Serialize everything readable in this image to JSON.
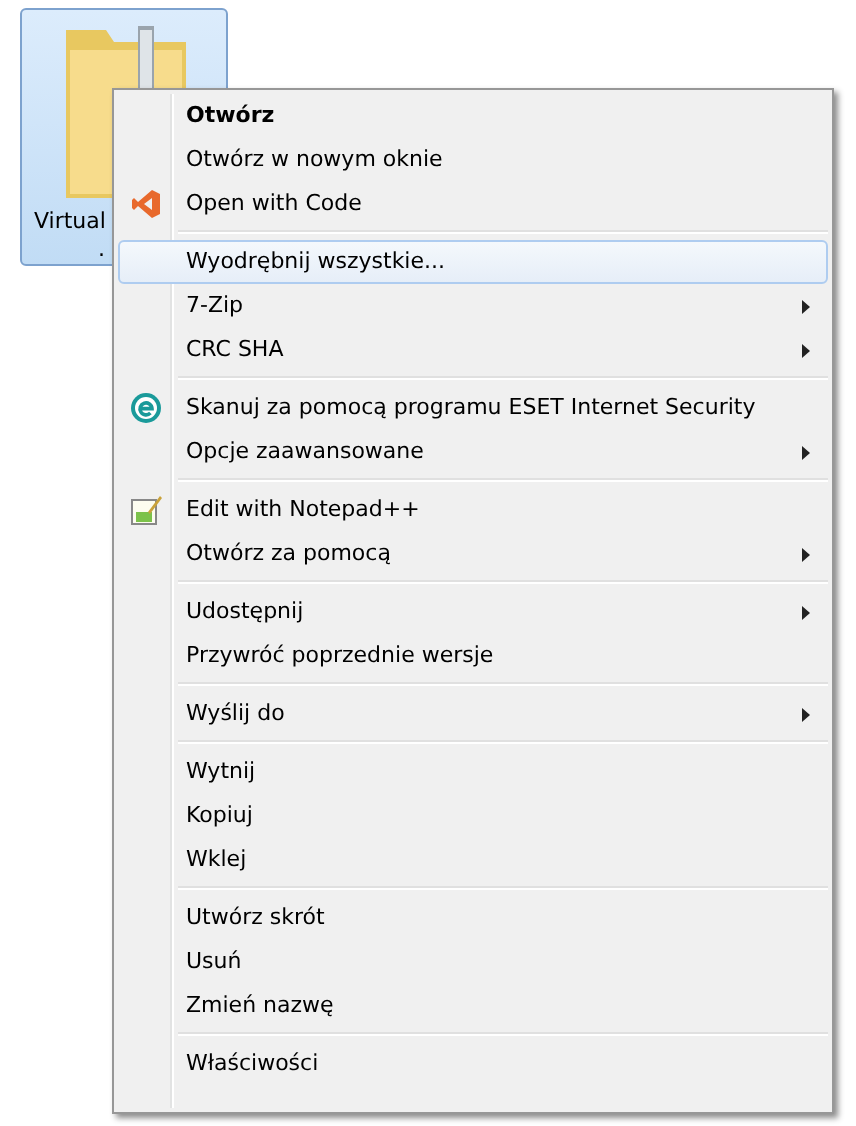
{
  "desktop_item": {
    "name_lines": [
      "Virtual",
      "."
    ],
    "selected": true
  },
  "context_menu": {
    "groups": [
      {
        "items": [
          {
            "label": "Otwórz",
            "default": true,
            "submenu": false,
            "selected": false
          },
          {
            "label": "Otwórz w nowym oknie",
            "default": false,
            "submenu": false,
            "selected": false
          },
          {
            "label": "Open with Code",
            "default": false,
            "submenu": false,
            "selected": false
          }
        ]
      },
      {
        "items": [
          {
            "label": "Wyodrębnij wszystkie...",
            "default": false,
            "submenu": false,
            "selected": true
          },
          {
            "label": "7-Zip",
            "default": false,
            "submenu": true,
            "selected": false
          },
          {
            "label": "CRC SHA",
            "default": false,
            "submenu": true,
            "selected": false
          }
        ]
      },
      {
        "items": [
          {
            "label": "Skanuj za pomocą programu ESET Internet Security",
            "default": false,
            "submenu": false,
            "selected": false
          },
          {
            "label": "Opcje zaawansowane",
            "default": false,
            "submenu": true,
            "selected": false
          }
        ]
      },
      {
        "items": [
          {
            "label": "Edit with Notepad++",
            "default": false,
            "submenu": false,
            "selected": false
          },
          {
            "label": "Otwórz za pomocą",
            "default": false,
            "submenu": true,
            "selected": false
          }
        ]
      },
      {
        "items": [
          {
            "label": "Udostępnij",
            "default": false,
            "submenu": true,
            "selected": false
          },
          {
            "label": "Przywróć poprzednie wersje",
            "default": false,
            "submenu": false,
            "selected": false
          }
        ]
      },
      {
        "items": [
          {
            "label": "Wyślij do",
            "default": false,
            "submenu": true,
            "selected": false
          }
        ]
      },
      {
        "items": [
          {
            "label": "Wytnij",
            "default": false,
            "submenu": false,
            "selected": false
          },
          {
            "label": "Kopiuj",
            "default": false,
            "submenu": false,
            "selected": false
          },
          {
            "label": "Wklej",
            "default": false,
            "submenu": false,
            "selected": false
          }
        ]
      },
      {
        "items": [
          {
            "label": "Utwórz skrót",
            "default": false,
            "submenu": false,
            "selected": false
          },
          {
            "label": "Usuń",
            "default": false,
            "submenu": false,
            "selected": false
          },
          {
            "label": "Zmień nazwę",
            "default": false,
            "submenu": false,
            "selected": false
          }
        ]
      },
      {
        "items": [
          {
            "label": "Właściwości",
            "default": false,
            "submenu": false,
            "selected": false
          }
        ]
      }
    ]
  }
}
